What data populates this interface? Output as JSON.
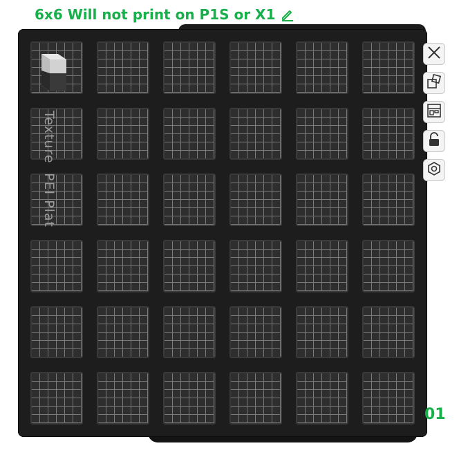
{
  "plate": {
    "title": "6x6 Will not print on P1S or X1",
    "number": "01",
    "bed_label_primary": "Texture",
    "bed_label_secondary": "PEI Plat",
    "grid": {
      "rows": 6,
      "cols": 6
    }
  },
  "toolbar": {
    "buttons": [
      {
        "name": "close-icon"
      },
      {
        "name": "auto-orient-icon"
      },
      {
        "name": "arrange-icon"
      },
      {
        "name": "lock-icon"
      },
      {
        "name": "settings-icon"
      }
    ]
  },
  "colors": {
    "accent": "#18b04a",
    "bed": "#1d1d1d",
    "cell": "#2e2e2e",
    "grid_line": "#7a7a7a"
  }
}
